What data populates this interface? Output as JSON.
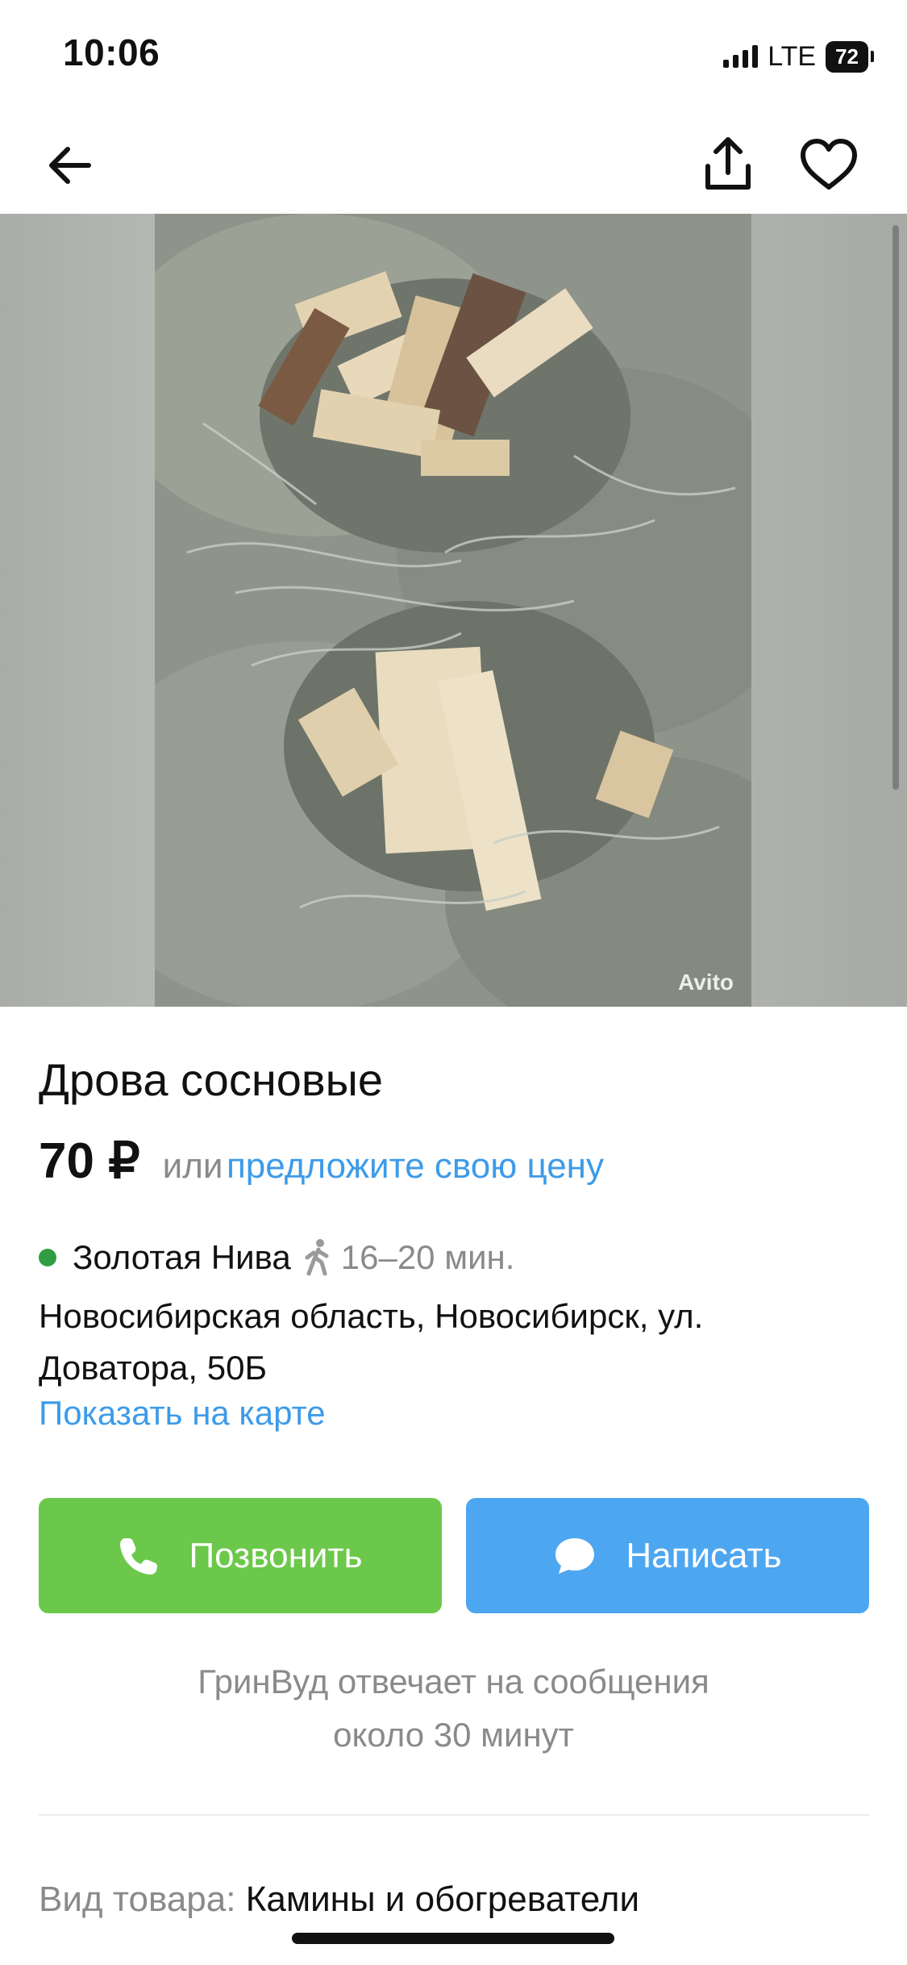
{
  "status_bar": {
    "time": "10:06",
    "network": "LTE",
    "battery": "72"
  },
  "nav": {
    "back_icon": "arrow-left-icon",
    "share_icon": "share-upload-icon",
    "favorite_icon": "heart-outline-icon"
  },
  "photo": {
    "watermark": "Avito"
  },
  "listing": {
    "title": "Дрова сосновые",
    "price": "70 ₽",
    "price_or": "или",
    "price_offer": "предложите свою цену"
  },
  "location": {
    "metro_color": "#2f9e43",
    "metro": "Золотая Нива",
    "walk_time": "16–20 мин.",
    "address": "Новосибирская область, Новосибирск, ул. Доватора, 50Б",
    "map_link": "Показать на карте"
  },
  "actions": {
    "call_label": "Позвонить",
    "call_color": "#6cc84a",
    "write_label": "Написать",
    "write_color": "#4da6f0"
  },
  "seller_note": {
    "line1": "ГринВуд отвечает на сообщения",
    "line2": "около 30 минут"
  },
  "specs": {
    "type_label": "Вид товара:",
    "type_value": "Камины и обогреватели"
  },
  "colors": {
    "link": "#3d9be9",
    "secondary_text": "#8a8a8a"
  }
}
